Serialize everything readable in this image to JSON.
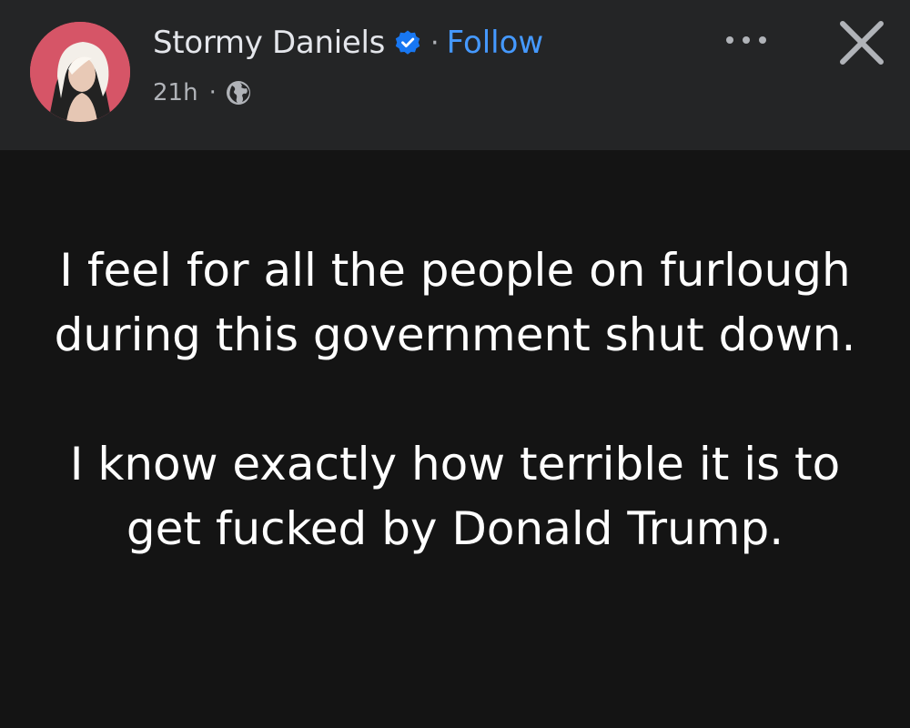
{
  "post": {
    "author": {
      "name": "Stormy Daniels",
      "verified": true,
      "verified_icon": "verified-badge-icon",
      "avatar": "profile-photo"
    },
    "separator": "·",
    "follow_label": "Follow",
    "meta": {
      "time": "21h",
      "separator": "·",
      "audience_icon": "globe-icon"
    },
    "actions": {
      "more_icon": "more-options-icon",
      "close_icon": "close-icon"
    },
    "text": {
      "paragraph_1": "I feel for all the people on furlough during this government shut down.",
      "paragraph_2": "I know exactly how terrible it is to get fucked by Donald Trump."
    }
  },
  "colors": {
    "header_bg": "#242526",
    "body_bg": "#141414",
    "name_text": "#e4e6eb",
    "secondary_text": "#b0b3b8",
    "follow_blue": "#4599ff",
    "verified_blue": "#1877f2",
    "post_text": "#ffffff"
  }
}
